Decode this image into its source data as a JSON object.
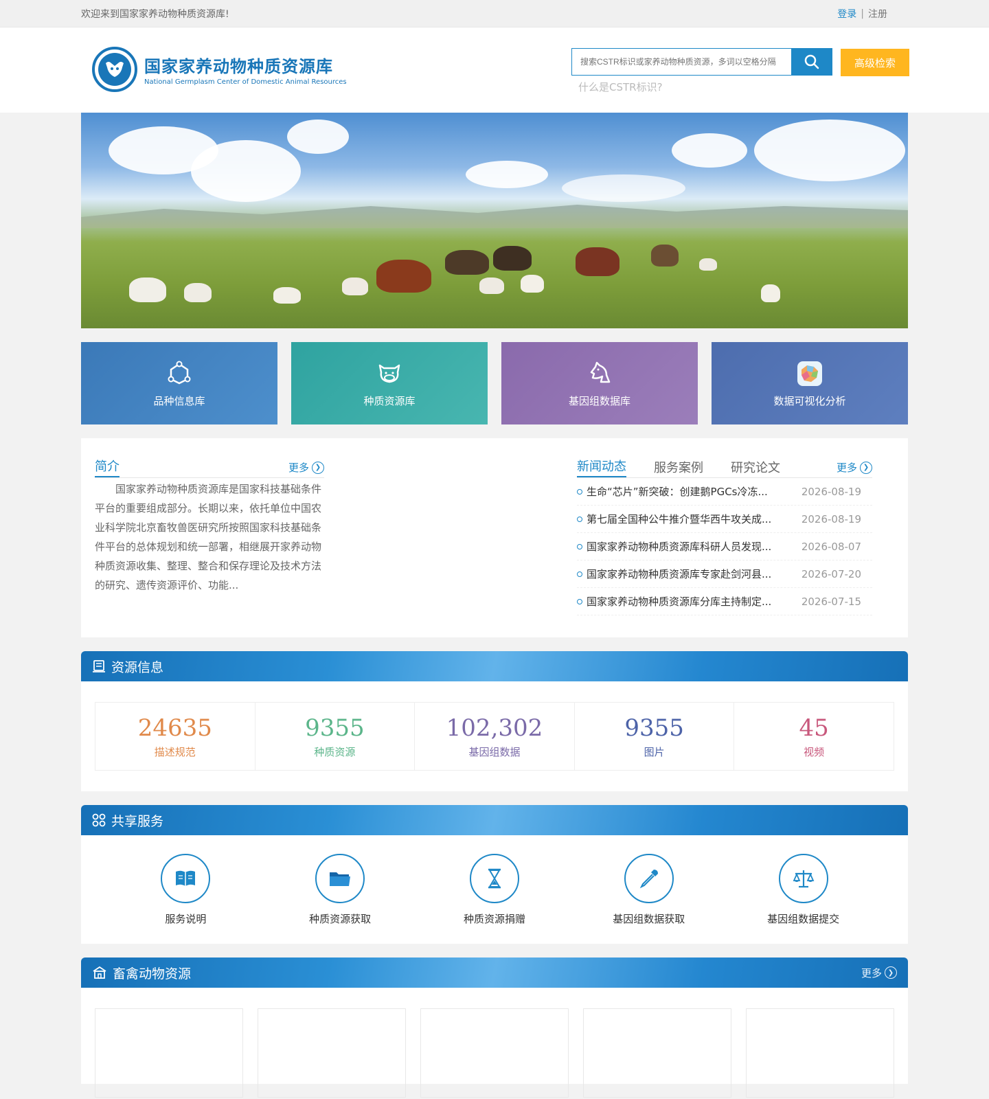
{
  "topbar": {
    "welcome": "欢迎来到国家家养动物种质资源库!",
    "login": "登录",
    "separator": "|",
    "register": "注册"
  },
  "header": {
    "logo_cn": "国家家养动物种质资源库",
    "logo_en": "National Germplasm Center of Domestic Animal Resources",
    "search_placeholder": "搜索CSTR标识或家养动物种质资源，多词以空格分隔",
    "search_icon": "search-icon",
    "advanced_search": "高级检索",
    "what_is_cstr": "什么是CSTR标识?"
  },
  "tiles": [
    {
      "label": "品种信息库",
      "icon": "network-icon"
    },
    {
      "label": "种质资源库",
      "icon": "cow-face-icon"
    },
    {
      "label": "基因组数据库",
      "icon": "horse-head-icon"
    },
    {
      "label": "数据可视化分析",
      "icon": "map-icon"
    }
  ],
  "intro": {
    "title": "简介",
    "more": "更多",
    "text": "国家家养动物种质资源库是国家科技基础条件平台的重要组成部分。长期以来，依托单位中国农业科学院北京畜牧兽医研究所按照国家科技基础条件平台的总体规划和统一部署，相继展开家养动物种质资源收集、整理、整合和保存理论及技术方法的研究、遗传资源评价、功能..."
  },
  "news": {
    "tabs": [
      "新闻动态",
      "服务案例",
      "研究论文"
    ],
    "more": "更多",
    "items": [
      {
        "title": "生命“芯片”新突破：创建鹅PGCs冷冻...",
        "date": "2026-08-19"
      },
      {
        "title": "第七届全国种公牛推介暨华西牛攻关成...",
        "date": "2026-08-19"
      },
      {
        "title": "国家家养动物种质资源库科研人员发现...",
        "date": "2026-08-07"
      },
      {
        "title": "国家家养动物种质资源库专家赴剑河县...",
        "date": "2026-07-20"
      },
      {
        "title": "国家家养动物种质资源库分库主持制定...",
        "date": "2026-07-15"
      }
    ]
  },
  "resources": {
    "title": "资源信息",
    "stats": [
      {
        "value": "24635",
        "label": "描述规范",
        "color": "#e0894a"
      },
      {
        "value": "9355",
        "label": "种质资源",
        "color": "#5bb58a"
      },
      {
        "value": "102,302",
        "label": "基因组数据",
        "color": "#7a6aa8"
      },
      {
        "value": "9355",
        "label": "图片",
        "color": "#4d63a8"
      },
      {
        "value": "45",
        "label": "视频",
        "color": "#c8587c"
      }
    ]
  },
  "services": {
    "title": "共享服务",
    "items": [
      {
        "label": "服务说明",
        "icon": "book-icon"
      },
      {
        "label": "种质资源获取",
        "icon": "folder-icon"
      },
      {
        "label": "种质资源捐赠",
        "icon": "hourglass-icon"
      },
      {
        "label": "基因组数据获取",
        "icon": "pipette-icon"
      },
      {
        "label": "基因组数据提交",
        "icon": "scale-icon"
      }
    ]
  },
  "livestock": {
    "title": "畜禽动物资源",
    "more": "更多"
  }
}
